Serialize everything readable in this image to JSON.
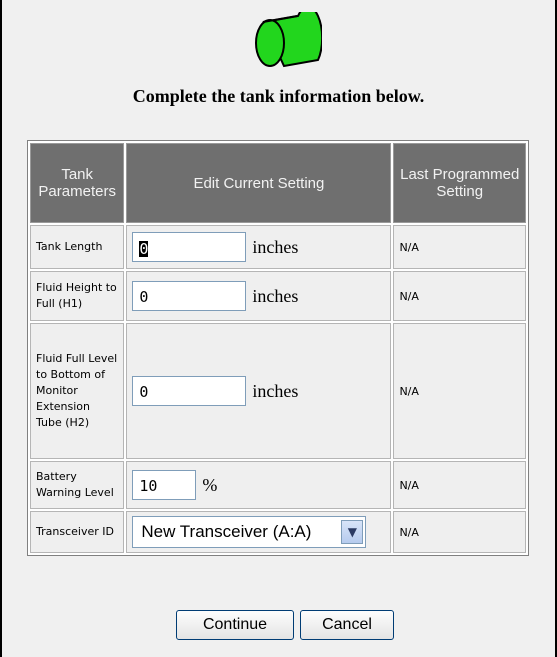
{
  "heading": "Complete the tank information below.",
  "colors": {
    "tank": "#22d61d",
    "header_bg": "#6f6f6f"
  },
  "table": {
    "headers": {
      "params": "Tank Parameters",
      "edit": "Edit Current Setting",
      "last": "Last Programmed Setting"
    },
    "rows": [
      {
        "label": "Tank Length",
        "value": "0",
        "unit": "inches",
        "last": "N/A"
      },
      {
        "label": "Fluid Height to Full (H1)",
        "value": "0",
        "unit": "inches",
        "last": "N/A"
      },
      {
        "label": "Fluid Full Level to Bottom of Monitor Extension Tube (H2)",
        "value": "0",
        "unit": "inches",
        "last": "N/A"
      },
      {
        "label": "Battery Warning Level",
        "value": "10",
        "unit": "%",
        "last": "N/A"
      },
      {
        "label": "Transceiver ID",
        "value": "New Transceiver (A:A)",
        "last": "N/A"
      }
    ]
  },
  "buttons": {
    "continue": "Continue",
    "cancel": "Cancel"
  }
}
